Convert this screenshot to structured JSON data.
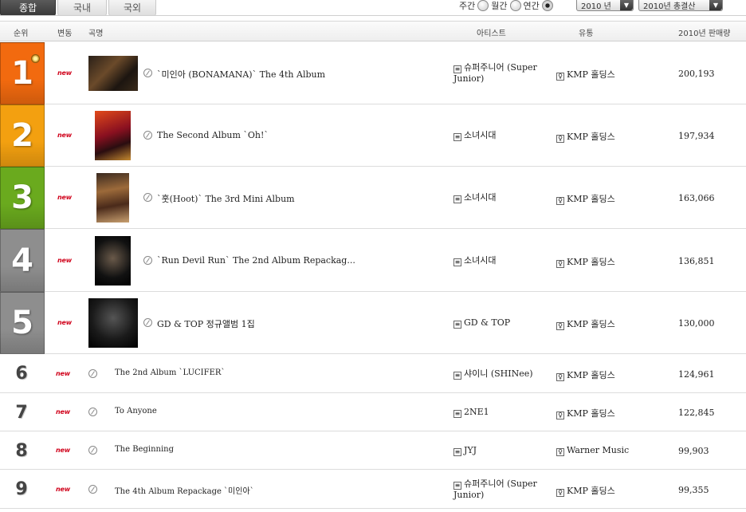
{
  "tabs": [
    "종합",
    "국내",
    "국외"
  ],
  "period": {
    "weekly": "주간",
    "monthly": "월간",
    "yearly": "연간",
    "selected": "연간"
  },
  "selects": {
    "year": "2010 년",
    "type": "2010년 총결산"
  },
  "header": {
    "rank": "순위",
    "change": "변동",
    "song": "곡명",
    "artist": "아티스트",
    "distributor": "유통",
    "sales": "2010년 판매량"
  },
  "badge": "new",
  "colors": {
    "rank1": "#f26a0f",
    "rank2": "#f3a010",
    "rank3": "#6aaa1e",
    "rank4": "#8e8e8e",
    "rank5": "#8e8e8e",
    "new": "#d0021b"
  },
  "rows": [
    {
      "rank": "1",
      "title": "`미인아 (BONAMANA)` The 4th Album",
      "artist": "슈퍼주니어 (Super Junior)",
      "distributor": "KMP 홀딩스",
      "sales": "200,193"
    },
    {
      "rank": "2",
      "title": "The Second Album `Oh!`",
      "artist": "소녀시대",
      "distributor": "KMP 홀딩스",
      "sales": "197,934"
    },
    {
      "rank": "3",
      "title": "`훗(Hoot)` The 3rd Mini Album",
      "artist": "소녀시대",
      "distributor": "KMP 홀딩스",
      "sales": "163,066"
    },
    {
      "rank": "4",
      "title": "`Run Devil Run` The 2nd Album Repackag...",
      "artist": "소녀시대",
      "distributor": "KMP 홀딩스",
      "sales": "136,851"
    },
    {
      "rank": "5",
      "title": "GD & TOP 정규앨범 1집",
      "artist": "GD & TOP",
      "distributor": "KMP 홀딩스",
      "sales": "130,000"
    },
    {
      "rank": "6",
      "title": "The 2nd Album `LUCIFER`",
      "artist": "샤이니 (SHINee)",
      "distributor": "KMP 홀딩스",
      "sales": "124,961"
    },
    {
      "rank": "7",
      "title": "To Anyone",
      "artist": "2NE1",
      "distributor": "KMP 홀딩스",
      "sales": "122,845"
    },
    {
      "rank": "8",
      "title": "The Beginning",
      "artist": "JYJ",
      "distributor": "Warner Music",
      "sales": "99,903"
    },
    {
      "rank": "9",
      "title": "The 4th Album Repackage `미인아`",
      "artist": "슈퍼주니어 (Super Junior)",
      "distributor": "KMP 홀딩스",
      "sales": "99,355"
    }
  ]
}
